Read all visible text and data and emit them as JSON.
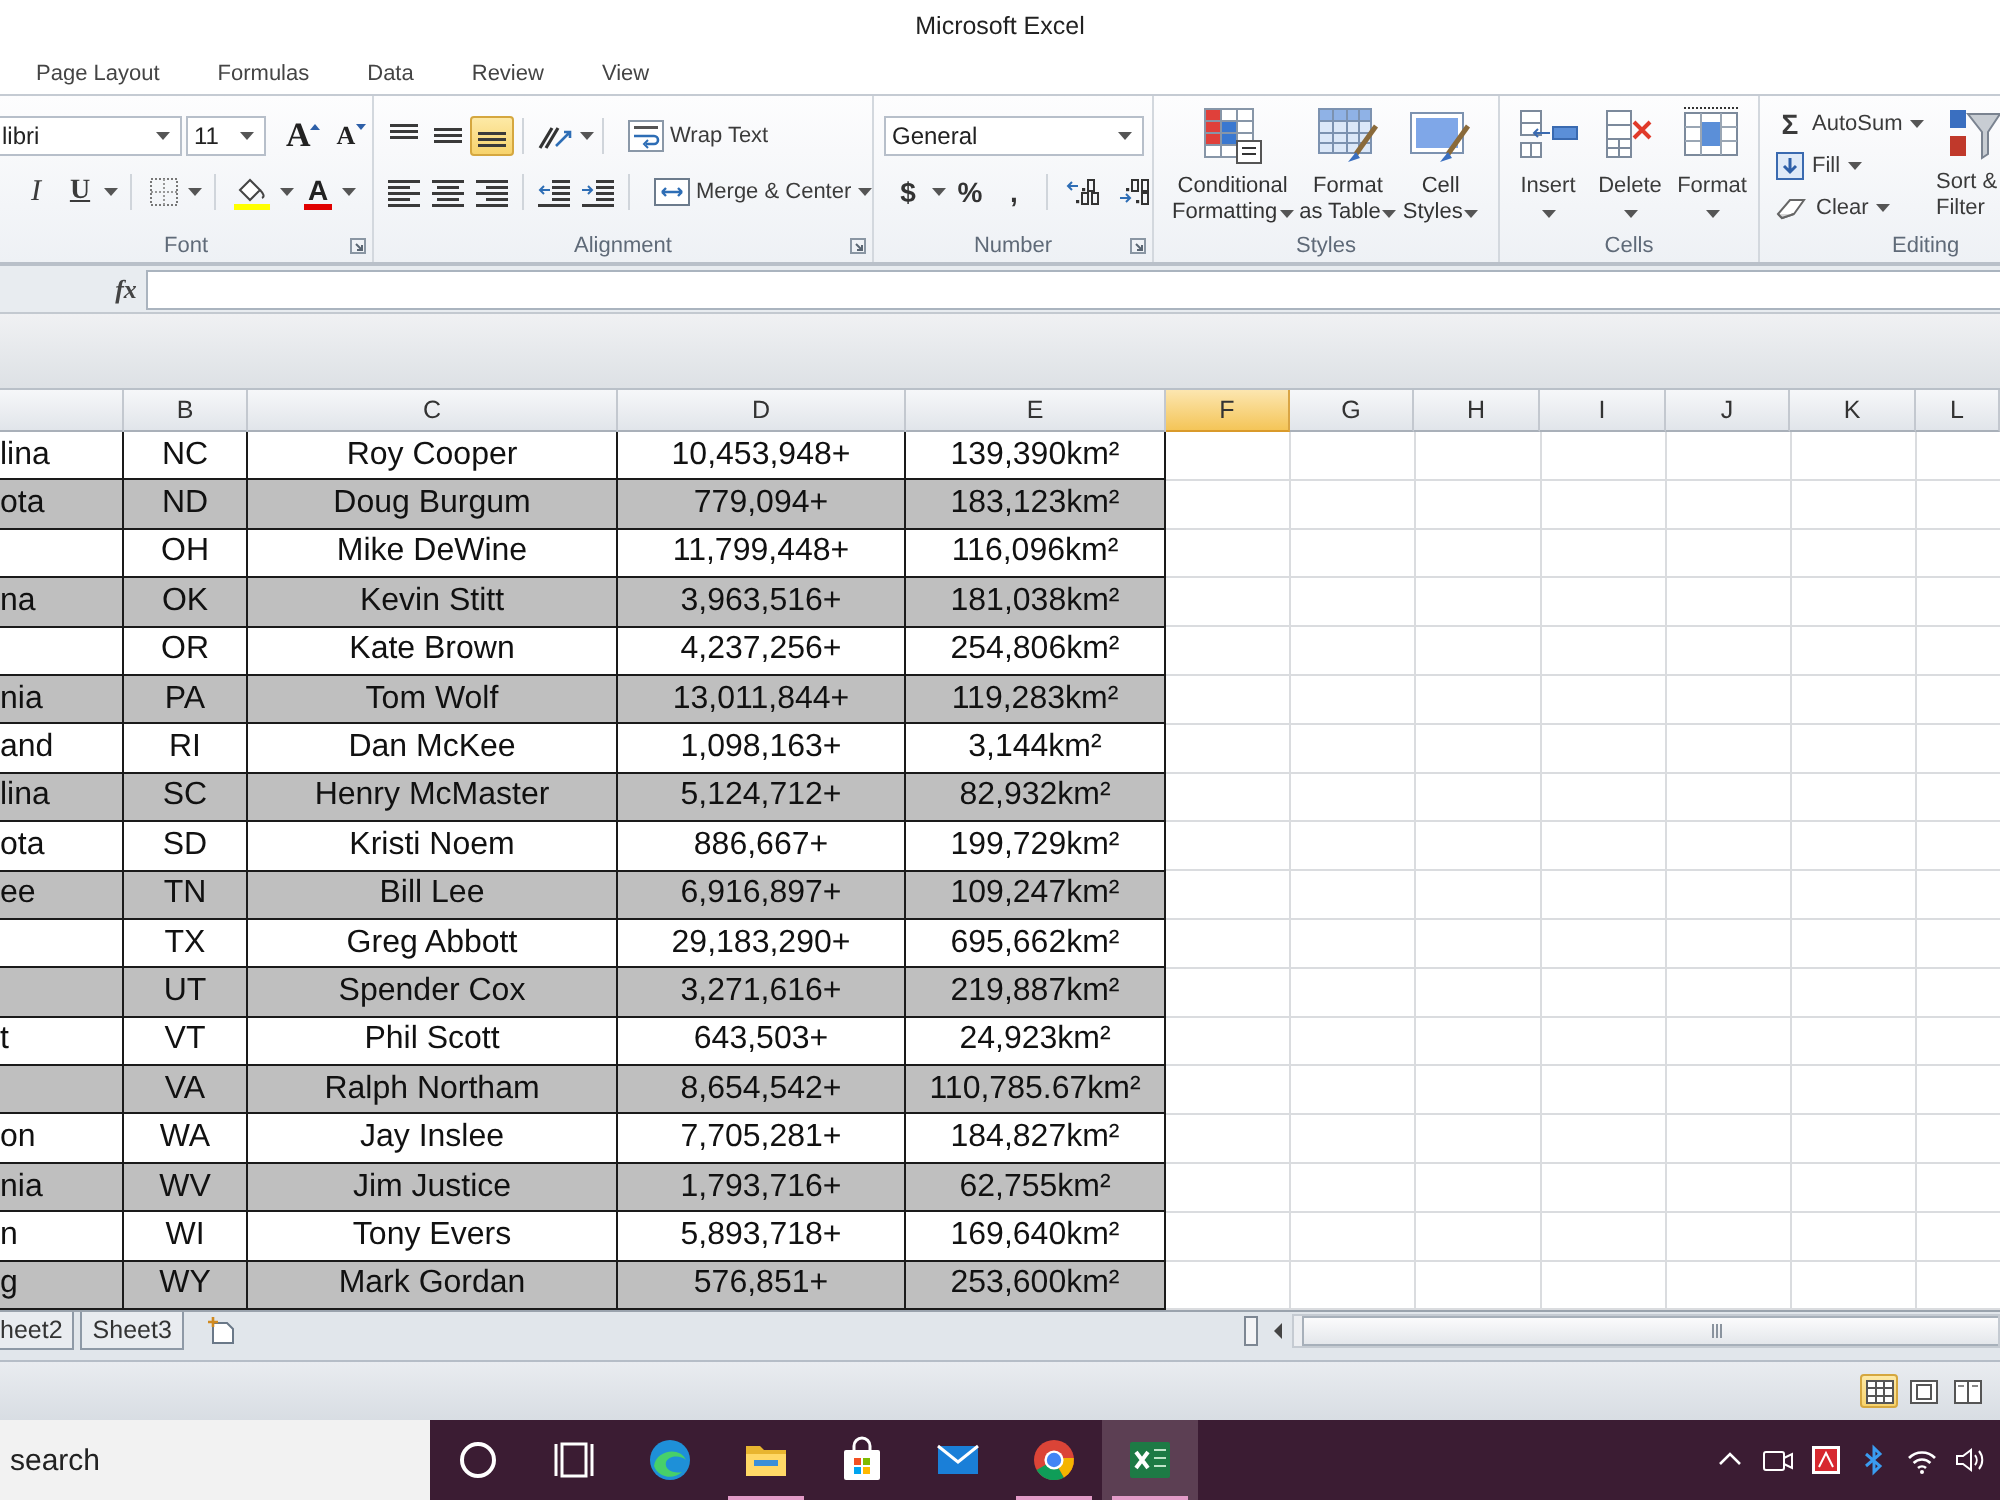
{
  "window": {
    "title": "Microsoft Excel"
  },
  "ribbon_tabs": [
    {
      "label": "Page Layout",
      "selected": false
    },
    {
      "label": "Formulas",
      "selected": false
    },
    {
      "label": "Data",
      "selected": false
    },
    {
      "label": "Review",
      "selected": false
    },
    {
      "label": "View",
      "selected": false
    }
  ],
  "ribbon": {
    "font": {
      "label": "Font",
      "name": "libri",
      "size": "11",
      "grow": "A",
      "shrink": "A",
      "italic": "I",
      "underline": "U",
      "color_letter": "A"
    },
    "alignment": {
      "label": "Alignment",
      "buttons": [
        {
          "kind": "top",
          "selected": false
        },
        {
          "kind": "middle",
          "selected": false
        },
        {
          "kind": "bottom",
          "selected": true
        },
        {
          "kind": "left",
          "selected": false
        },
        {
          "kind": "center",
          "selected": false
        },
        {
          "kind": "right",
          "selected": false
        }
      ],
      "wrap": "Wrap Text",
      "merge": "Merge & Center"
    },
    "number": {
      "label": "Number",
      "format": "General",
      "currency": "$",
      "percent": "%",
      "comma": ","
    },
    "styles": {
      "label": "Styles",
      "buttons": [
        {
          "kind": "conditional",
          "lines": [
            "Conditional",
            "Formatting"
          ]
        },
        {
          "kind": "table",
          "lines": [
            "Format",
            "as Table"
          ]
        },
        {
          "kind": "cell",
          "lines": [
            "Cell",
            "Styles"
          ]
        }
      ]
    },
    "cells": {
      "label": "Cells",
      "buttons": [
        {
          "kind": "insert",
          "label": "Insert"
        },
        {
          "kind": "delete",
          "label": "Delete"
        },
        {
          "kind": "format",
          "label": "Format"
        }
      ]
    },
    "editing": {
      "label": "Editing",
      "autosum_symbol": "Σ",
      "autosum": "AutoSum",
      "fill": "Fill",
      "clear": "Clear",
      "sort_lines": [
        "Sort &",
        "Filter"
      ]
    }
  },
  "formula_bar": {
    "function_label": "fx"
  },
  "sheet": {
    "columns": [
      {
        "selected": false
      },
      {
        "label": "B",
        "selected": false
      },
      {
        "label": "C",
        "selected": false
      },
      {
        "label": "D",
        "selected": false
      },
      {
        "label": "E",
        "selected": false
      },
      {
        "label": "F",
        "selected": true
      },
      {
        "label": "G",
        "selected": false
      },
      {
        "label": "H",
        "selected": false
      },
      {
        "label": "I",
        "selected": false
      },
      {
        "label": "J",
        "selected": false
      },
      {
        "label": "K",
        "selected": false
      },
      {
        "label": "L",
        "selected": false
      }
    ],
    "rows": [
      {
        "a": "lina",
        "b": "NC",
        "c": "Roy Cooper",
        "d": "10,453,948+",
        "e": "139,390km²",
        "shaded": false
      },
      {
        "a": "ota",
        "b": "ND",
        "c": "Doug Burgum",
        "d": "779,094+",
        "e": "183,123km²",
        "shaded": true
      },
      {
        "b": "OH",
        "c": "Mike DeWine",
        "d": "11,799,448+",
        "e": "116,096km²",
        "shaded": false
      },
      {
        "a": "na",
        "b": "OK",
        "c": "Kevin Stitt",
        "d": "3,963,516+",
        "e": "181,038km²",
        "shaded": true
      },
      {
        "b": "OR",
        "c": "Kate Brown",
        "d": "4,237,256+",
        "e": "254,806km²",
        "shaded": false
      },
      {
        "a": "nia",
        "b": "PA",
        "c": "Tom Wolf",
        "d": "13,011,844+",
        "e": "119,283km²",
        "shaded": true
      },
      {
        "a": "and",
        "b": "RI",
        "c": "Dan McKee",
        "d": "1,098,163+",
        "e": "3,144km²",
        "shaded": false
      },
      {
        "a": "lina",
        "b": "SC",
        "c": "Henry McMaster",
        "d": "5,124,712+",
        "e": "82,932km²",
        "shaded": true
      },
      {
        "a": "ota",
        "b": "SD",
        "c": "Kristi Noem",
        "d": "886,667+",
        "e": "199,729km²",
        "shaded": false
      },
      {
        "a": "ee",
        "b": "TN",
        "c": "Bill Lee",
        "d": "6,916,897+",
        "e": "109,247km²",
        "shaded": true
      },
      {
        "b": "TX",
        "c": "Greg Abbott",
        "d": "29,183,290+",
        "e": "695,662km²",
        "shaded": false
      },
      {
        "b": "UT",
        "c": "Spender Cox",
        "d": "3,271,616+",
        "e": "219,887km²",
        "shaded": true
      },
      {
        "a": "t",
        "b": "VT",
        "c": "Phil Scott",
        "d": "643,503+",
        "e": "24,923km²",
        "shaded": false
      },
      {
        "b": "VA",
        "c": "Ralph Northam",
        "d": "8,654,542+",
        "e": "110,785.67km²",
        "shaded": true
      },
      {
        "a": "on",
        "b": "WA",
        "c": "Jay Inslee",
        "d": "7,705,281+",
        "e": "184,827km²",
        "shaded": false
      },
      {
        "a": "nia",
        "b": "WV",
        "c": "Jim Justice",
        "d": "1,793,716+",
        "e": "62,755km²",
        "shaded": true
      },
      {
        "a": "n",
        "b": "WI",
        "c": "Tony Evers",
        "d": "5,893,718+",
        "e": "169,640km²",
        "shaded": false
      },
      {
        "a": "g",
        "b": "WY",
        "c": "Mark Gordan",
        "d": "576,851+",
        "e": "253,600km²",
        "shaded": true
      }
    ]
  },
  "sheet_tabs": [
    {
      "label": "heet2",
      "selected": false
    },
    {
      "label": "Sheet3",
      "selected": false
    }
  ],
  "status_bar": {
    "view_buttons": [
      {
        "kind": "normal",
        "selected": true
      },
      {
        "kind": "page_layout",
        "selected": false
      },
      {
        "kind": "page_break",
        "selected": false
      }
    ]
  },
  "taskbar": {
    "search": {
      "placeholder": "search"
    },
    "apps": [
      {
        "kind": "cortana",
        "running": false,
        "selected": false
      },
      {
        "kind": "task_view",
        "running": false,
        "selected": false
      },
      {
        "kind": "edge",
        "running": false,
        "selected": false
      },
      {
        "kind": "explorer",
        "running": true,
        "selected": false
      },
      {
        "kind": "store",
        "running": false,
        "selected": false
      },
      {
        "kind": "mail",
        "running": false,
        "selected": false
      },
      {
        "kind": "chrome",
        "running": true,
        "selected": false
      },
      {
        "kind": "excel",
        "running": true,
        "selected": true
      }
    ]
  }
}
